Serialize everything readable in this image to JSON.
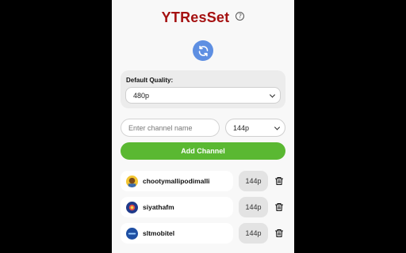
{
  "app": {
    "title": "YTResSet",
    "help_icon": "?"
  },
  "refresh": {
    "icon": "refresh-icon",
    "color": "#5e8fe2"
  },
  "default_quality": {
    "label": "Default Quality:",
    "selected": "480p"
  },
  "add_form": {
    "channel_placeholder": "Enter channel name",
    "channel_value": "",
    "quality_selected": "144p",
    "add_button_label": "Add Channel",
    "add_button_color": "#5ab832"
  },
  "channels": [
    {
      "name": "chootymallipodimalli",
      "quality": "144p",
      "avatar_color": "#f2c531"
    },
    {
      "name": "siyathafm",
      "quality": "144p",
      "avatar_color": "#1f3a8a"
    },
    {
      "name": "sltmobitel",
      "quality": "144p",
      "avatar_color": "#1e4fa3"
    }
  ],
  "colors": {
    "title": "#a51111",
    "background": "#f8f8f8"
  }
}
